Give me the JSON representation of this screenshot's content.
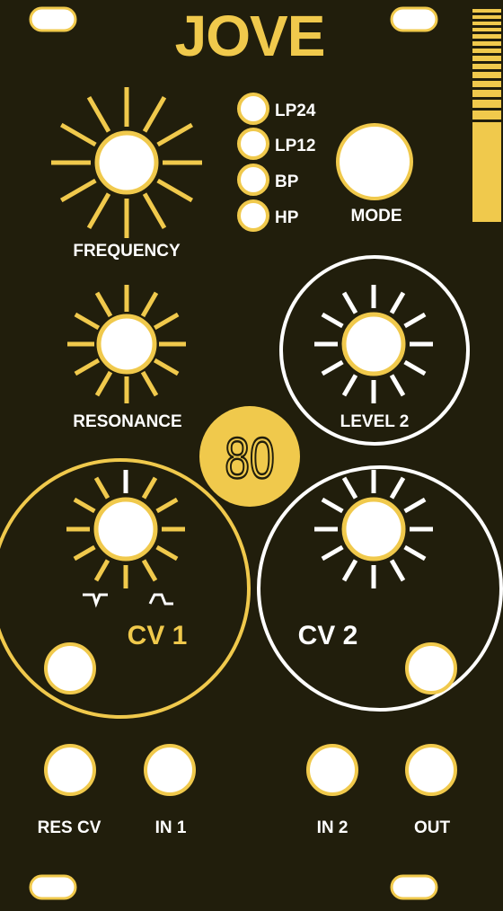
{
  "panel": {
    "title": "JOVE",
    "logo_number": "80"
  },
  "colors": {
    "panel_bg": "#211e0c",
    "accent": "#f0c94c",
    "white": "#ffffff",
    "knob_face": "#ffffff"
  },
  "modes": {
    "items": [
      "LP24",
      "LP12",
      "BP",
      "HP"
    ],
    "button_label": "MODE"
  },
  "knobs": {
    "frequency_label": "FREQUENCY",
    "resonance_label": "RESONANCE",
    "level2_label": "LEVEL 2"
  },
  "cv": {
    "cv1_label": "CV 1",
    "cv2_label": "CV 2"
  },
  "jacks": {
    "res_cv_label": "RES CV",
    "in1_label": "IN 1",
    "in2_label": "IN 2",
    "out_label": "OUT"
  }
}
